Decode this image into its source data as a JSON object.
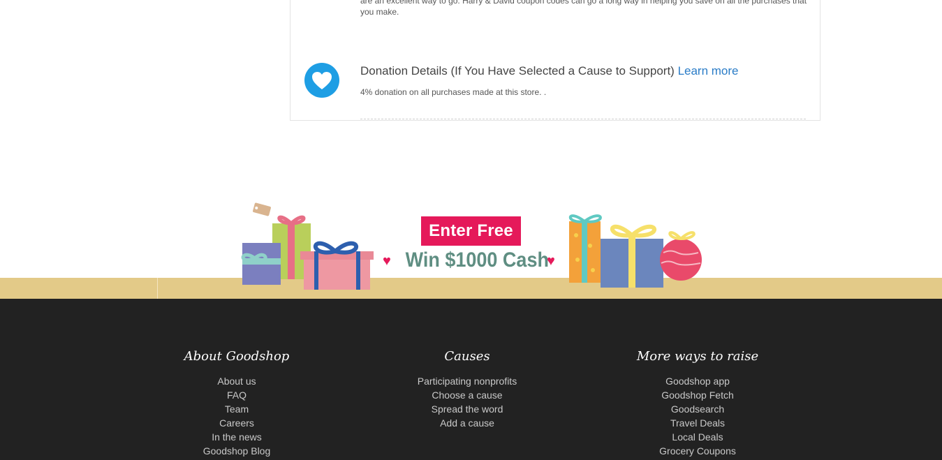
{
  "store_info": {
    "intro_text": "are an excellent way to go. Harry & David coupon codes can go a long way in helping you save on all the purchases that you make."
  },
  "donation": {
    "icon": "heart-icon",
    "title": "Donation Details (If You Have Selected a Cause to Support)",
    "learn_more": "Learn more",
    "subtitle": "4% donation on all purchases made at this store. ."
  },
  "promo": {
    "enter_label": "Enter Free",
    "headline": "Win $1000 Cash",
    "accent": "#e5195a",
    "headline_color": "#5f8e82",
    "ground_color": "#e3ca88"
  },
  "footer": {
    "background": "#222222",
    "columns": [
      {
        "title": "About Goodshop",
        "links": [
          "About us",
          "FAQ",
          "Team",
          "Careers",
          "In the news",
          "Goodshop Blog"
        ]
      },
      {
        "title": "Causes",
        "links": [
          "Participating nonprofits",
          "Choose a cause",
          "Spread the word",
          "Add a cause"
        ]
      },
      {
        "title": "More ways to raise",
        "links": [
          "Goodshop app",
          "Goodshop Fetch",
          "Goodsearch",
          "Travel Deals",
          "Local Deals",
          "Grocery Coupons"
        ]
      }
    ]
  }
}
